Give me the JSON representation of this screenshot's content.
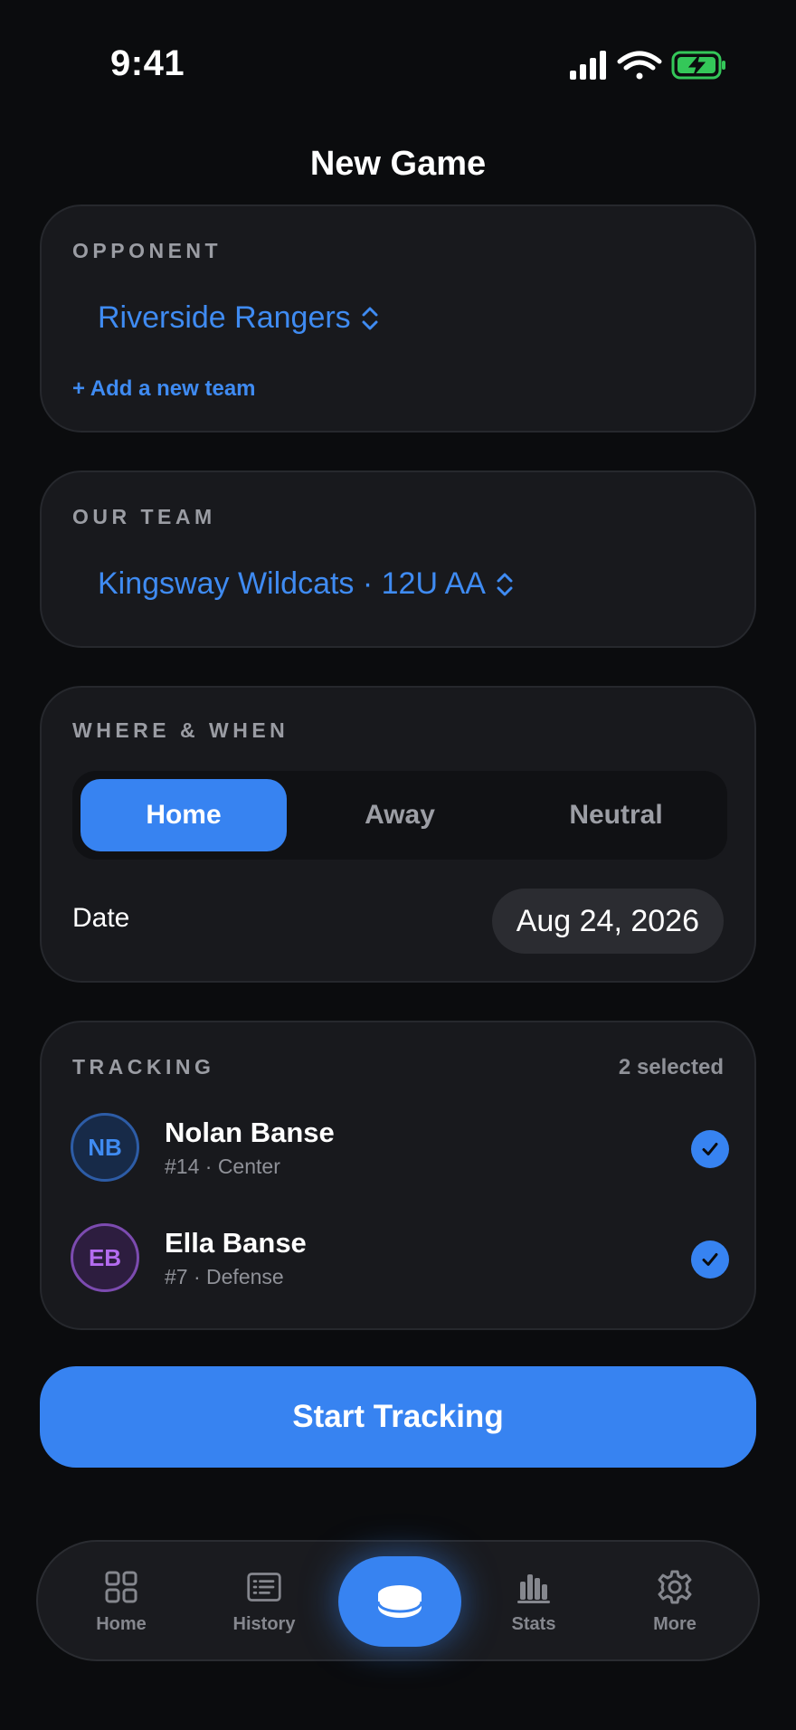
{
  "status_bar": {
    "time": "9:41"
  },
  "title": "New Game",
  "opponent": {
    "label": "OPPONENT",
    "team": "Riverside Rangers",
    "add_link": "+ Add a new team"
  },
  "our_team": {
    "label": "OUR TEAM",
    "team": "Kingsway Wildcats · 12U AA"
  },
  "where_when": {
    "label": "WHERE & WHEN",
    "options": [
      "Home",
      "Away",
      "Neutral"
    ],
    "selected": "Home",
    "date_label": "Date",
    "date_value": "Aug 24, 2026"
  },
  "tracking": {
    "label": "TRACKING",
    "count_text": "2 selected",
    "players": [
      {
        "initials": "NB",
        "name": "Nolan Banse",
        "meta": "#14 · Center",
        "checked": true
      },
      {
        "initials": "EB",
        "name": "Ella Banse",
        "meta": "#7 · Defense",
        "checked": true
      }
    ]
  },
  "start_button": "Start Tracking",
  "tabbar": {
    "items": [
      {
        "label": "Home",
        "icon": "grid-icon"
      },
      {
        "label": "History",
        "icon": "list-icon"
      },
      {
        "label": "",
        "icon": "puck-icon"
      },
      {
        "label": "Stats",
        "icon": "bar-chart-icon"
      },
      {
        "label": "More",
        "icon": "gear-icon"
      }
    ]
  },
  "colors": {
    "accent": "#3783f1",
    "link": "#3f8bf2",
    "card": "#18191d",
    "background": "#0b0c0e",
    "battery": "#34c759"
  }
}
